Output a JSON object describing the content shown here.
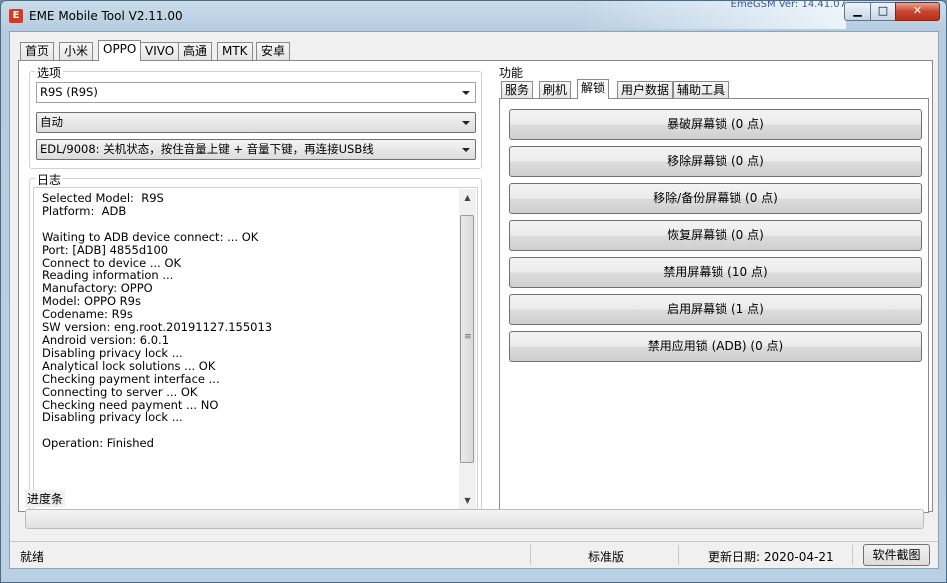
{
  "window": {
    "title": "EME Mobile Tool V2.11.00",
    "background_text": "EmeGSM  Ver: 14.41.07",
    "minimize": "▁",
    "maximize": "□",
    "close": "✕"
  },
  "main_tabs": [
    {
      "label": "首页"
    },
    {
      "label": "小米"
    },
    {
      "label": "OPPO"
    },
    {
      "label": "VIVO"
    },
    {
      "label": "高通"
    },
    {
      "label": "MTK"
    },
    {
      "label": "安卓"
    }
  ],
  "options": {
    "title": "选项",
    "model_value": "R9S (R9S)",
    "mode_value": "自动",
    "method_value": "EDL/9008: 关机状态，按住音量上键 + 音量下键，再连接USB线"
  },
  "log": {
    "title": "日志",
    "text": "Selected Model:  R9S\nPlatform:  ADB\n\nWaiting to ADB device connect: ... OK\nPort: [ADB] 4855d100\nConnect to device ... OK\nReading information ...\nManufactory: OPPO\nModel: OPPO R9s\nCodename: R9s\nSW version: eng.root.20191127.155013\nAndroid version: 6.0.1\nDisabling privacy lock ...\nAnalytical lock solutions ... OK\nChecking payment interface ...\nConnecting to server ... OK\nChecking need payment ... NO\nDisabling privacy lock ...\n\nOperation: Finished",
    "scroll_up": "▲",
    "scroll_down": "▼",
    "scroll_grip": "≡"
  },
  "functions": {
    "title": "功能",
    "tabs": [
      {
        "label": "服务"
      },
      {
        "label": "刷机"
      },
      {
        "label": "解锁"
      },
      {
        "label": "用户数据"
      },
      {
        "label": "辅助工具"
      }
    ],
    "buttons": [
      {
        "label": "暴破屏幕锁 (0 点)"
      },
      {
        "label": "移除屏幕锁 (0 点)"
      },
      {
        "label": "移除/备份屏幕锁 (0 点)"
      },
      {
        "label": "恢复屏幕锁 (0 点)"
      },
      {
        "label": "禁用屏幕锁 (10 点)"
      },
      {
        "label": "启用屏幕锁 (1 点)"
      },
      {
        "label": "禁用应用锁 (ADB) (0 点)"
      }
    ]
  },
  "progress": {
    "title": "进度条",
    "value": 0
  },
  "status": {
    "state": "就绪",
    "edition": "标准版",
    "update_date": "更新日期:  2020-04-21",
    "screenshot_button": "软件截图"
  }
}
